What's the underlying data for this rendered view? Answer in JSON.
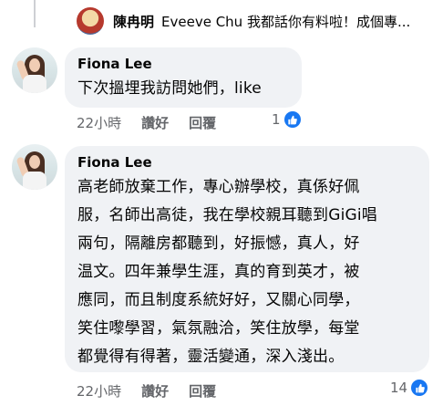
{
  "reply_preview": {
    "name": "陳冉明",
    "text": "Eveeve Chu 我都話你有料啦！成個專..."
  },
  "comments": [
    {
      "author": "Fiona Lee",
      "text": "下次搵埋我訪問她們，like",
      "time": "22小時",
      "like_label": "讚好",
      "reply_label": "回覆",
      "reaction_count": "1",
      "reaction_icon": "like-thumb-icon"
    },
    {
      "author": "Fiona Lee",
      "lines": [
        "高老師放棄工作，專心辦學校，真係好佩",
        "服，名師出高徒，我在學校親耳聽到GiGi唱",
        "兩句，隔離房都聽到，好振憾，真人，好",
        "温文。四年兼學生涯，真的育到英才，被",
        "應同，而且制度系統好好，又關心同學，",
        "笑住嚟學習，氣氛融洽，笑住放學，每堂",
        "都覺得有得著，靈活變通，深入淺出。"
      ],
      "time": "22小時",
      "like_label": "讚好",
      "reply_label": "回覆",
      "reaction_count": "14",
      "reaction_icon": "like-thumb-icon"
    }
  ],
  "colors": {
    "bubble": "#f0f2f5",
    "meta_text": "#65676b",
    "like_blue": "#1877f2"
  }
}
